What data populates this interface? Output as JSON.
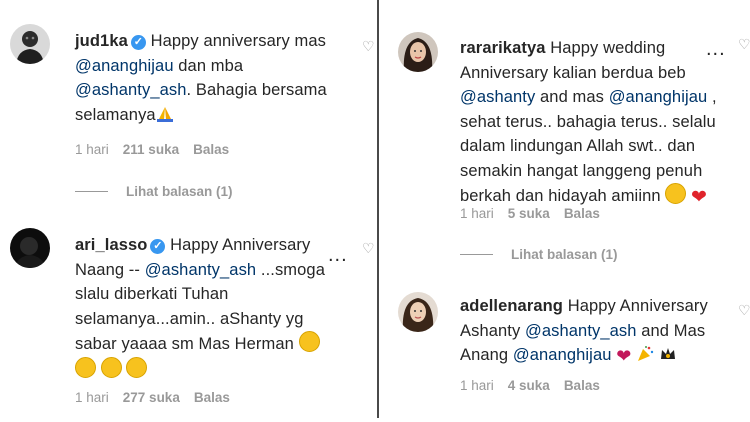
{
  "left": {
    "comments": [
      {
        "username": "jud1ka",
        "verified": true,
        "line1": "Happy anniversary mas",
        "line2_mention": "@ananghijau",
        "line2_rest": " dan mba",
        "line3_mention": "@ashanty_ash",
        "line3_rest": ". Bahagia bersama",
        "line4": "selamanya",
        "line4_emoji": "folded-hands-emoji",
        "time": "1 hari",
        "likes": "211 suka",
        "reply": "Balas",
        "view_replies": "Lihat balasan (1)"
      },
      {
        "username": "ari_lasso",
        "verified": true,
        "line1": "Happy Anniversary",
        "line2_a": "Naang -- ",
        "line2_mention": "@ashanty_ash",
        "line2_b": " ...smoga",
        "line3": "slalu diberkati Tuhan",
        "line4": "selamanya...amin.. aShanty yg",
        "line5": "sabar yaaaa sm Mas Herman",
        "emoji_name": "tears-of-joy-emoji",
        "time": "1 hari",
        "likes": "277 suka",
        "reply": "Balas",
        "more": "..."
      }
    ]
  },
  "right": {
    "comments": [
      {
        "username": "rararikatya",
        "line1": "Happy wedding",
        "line2": "Anniversary kalian berdua beb",
        "line3_mention": "@ashanty",
        "line3_mid": " and mas ",
        "line3_mention2": "@ananghijau",
        "line3_end": " ,",
        "line4": "sehat terus.. bahagia terus.. selalu",
        "line5": "dalam lindungan Allah swt.. dan",
        "line6": "semakin hangat langgeng penuh",
        "line7": "berkah dan hidayah amiinn",
        "time": "1 hari",
        "likes": "5 suka",
        "reply": "Balas",
        "view_replies": "Lihat balasan (1)",
        "more": "..."
      },
      {
        "username": "adellenarang",
        "line1": "Happy Anniversary",
        "line2_a": "Ashanty ",
        "line2_mention": "@ashanty_ash",
        "line2_b": " and Mas",
        "line3_a": "Anang ",
        "line3_mention": "@ananghijau",
        "time": "1 hari",
        "likes": "4 suka",
        "reply": "Balas"
      }
    ]
  },
  "colors": {
    "mention": "#003569",
    "meta": "#999999",
    "verified": "#3897f0",
    "divider": "#4a4a4a"
  }
}
